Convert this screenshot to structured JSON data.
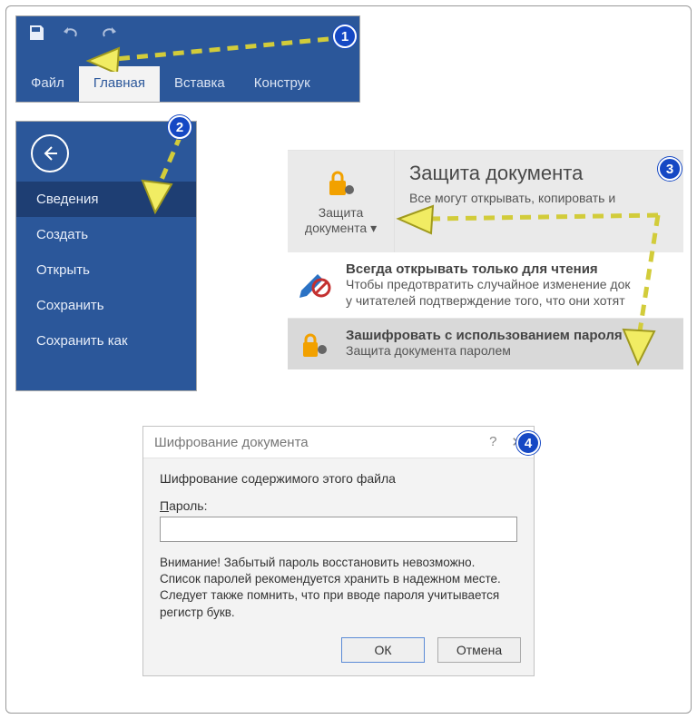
{
  "badges": {
    "b1": "1",
    "b2": "2",
    "b3": "3",
    "b4": "4"
  },
  "ribbon": {
    "tabs": {
      "file": "Файл",
      "home": "Главная",
      "insert": "Вставка",
      "design": "Конструк"
    }
  },
  "backstage": {
    "items": {
      "info": "Сведения",
      "create": "Создать",
      "open": "Открыть",
      "save": "Сохранить",
      "saveas": "Сохранить как"
    }
  },
  "protect": {
    "button_line1": "Защита",
    "button_line2": "документа",
    "title": "Защита документа",
    "subtitle": "Все могут открывать, копировать и ",
    "readonly_title": "Всегда открывать только для чтения",
    "readonly_desc1": "Чтобы предотвратить случайное изменение док",
    "readonly_desc2": "у читателей подтверждение того, что они хотят",
    "encrypt_title": "Зашифровать с использованием пароля",
    "encrypt_desc": "Защита документа паролем"
  },
  "dialog": {
    "title": "Шифрование документа",
    "help": "?",
    "close": "✕",
    "heading": "Шифрование содержимого этого файла",
    "password_label_u": "П",
    "password_label_rest": "ароль:",
    "password_value": "",
    "warning_l1": "Внимание! Забытый пароль восстановить невозможно.",
    "warning_l2": "Список паролей рекомендуется хранить в надежном месте.",
    "warning_l3": "Следует также помнить, что при вводе пароля учитывается регистр букв.",
    "ok": "ОК",
    "cancel": "Отмена"
  }
}
